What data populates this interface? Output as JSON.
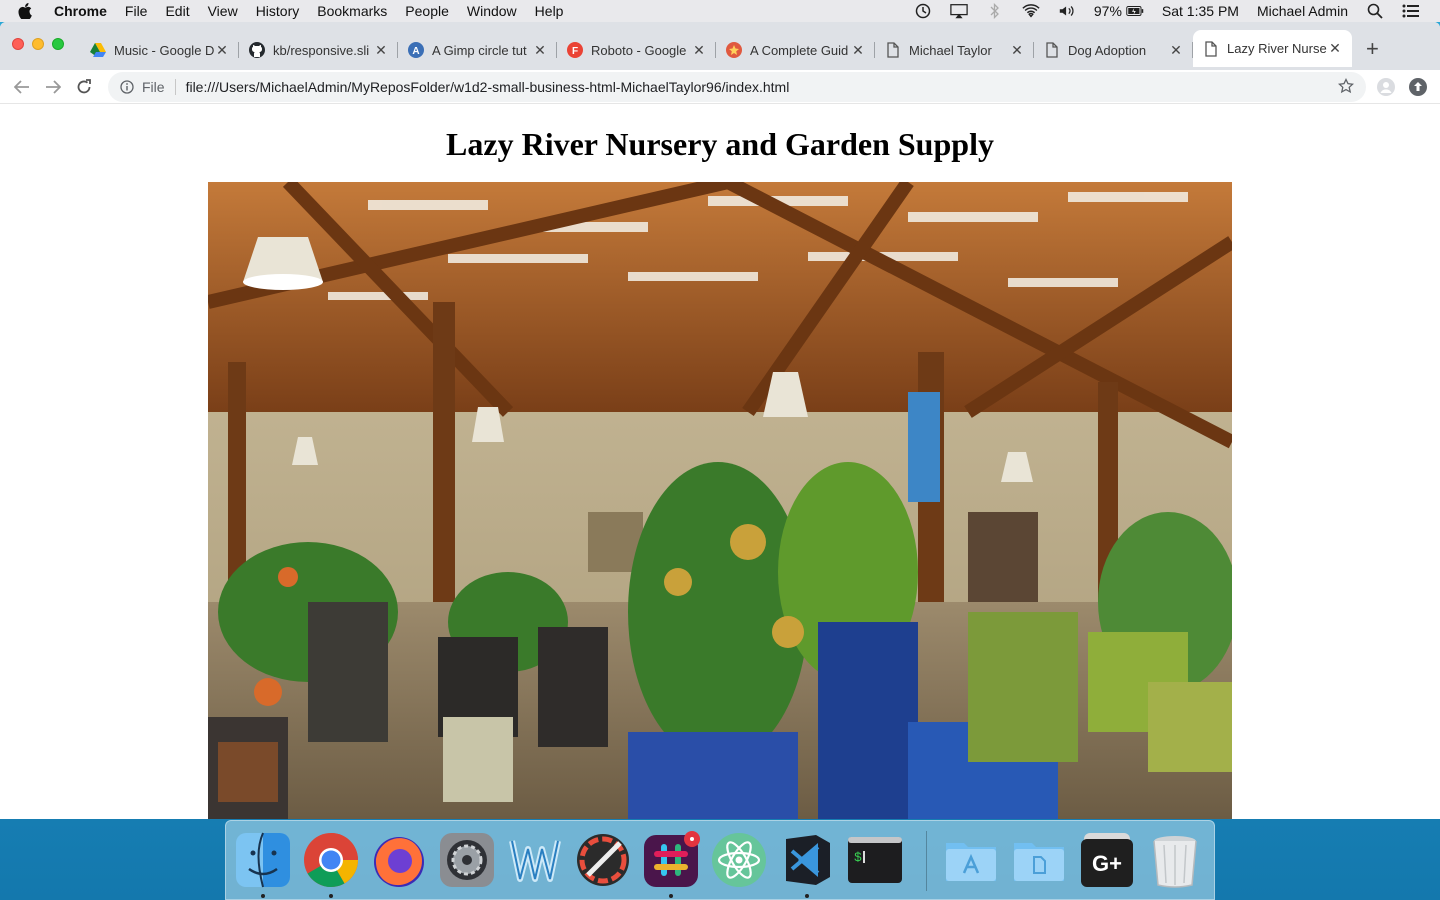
{
  "menubar": {
    "app_name": "Chrome",
    "items": [
      "File",
      "Edit",
      "View",
      "History",
      "Bookmarks",
      "People",
      "Window",
      "Help"
    ],
    "battery": "97%",
    "clock": "Sat 1:35 PM",
    "user": "Michael Admin"
  },
  "browser": {
    "tabs": [
      {
        "title": "Music - Google D",
        "icon": "google-drive-icon"
      },
      {
        "title": "kb/responsive.sli",
        "icon": "github-icon"
      },
      {
        "title": "A Gimp circle tut",
        "icon": "gimp-site-icon"
      },
      {
        "title": "Roboto - Google",
        "icon": "google-fonts-icon"
      },
      {
        "title": "A Complete Guid",
        "icon": "css-tricks-icon"
      },
      {
        "title": "Michael Taylor",
        "icon": "document-icon"
      },
      {
        "title": "Dog Adoption",
        "icon": "document-icon"
      },
      {
        "title": "Lazy River Nurse",
        "icon": "document-icon",
        "active": true
      }
    ],
    "address": {
      "scheme_label": "File",
      "url": "file:///Users/MichaelAdmin/MyReposFolder/w1d2-small-business-html-MichaelTaylor96/index.html"
    }
  },
  "page": {
    "heading": "Lazy River Nursery and Garden Supply",
    "hero_alt": "Garden center interior with potted plants and hanging lamps"
  },
  "dock": {
    "apps": [
      "Finder",
      "Google Chrome",
      "Firefox",
      "System Preferences",
      "Wunderlist",
      "Pixelmator",
      "Slack",
      "Atom",
      "Visual Studio Code",
      "Terminal",
      "Applications",
      "Documents",
      "Google Plus",
      "Trash"
    ]
  },
  "colors": {
    "tabstrip": "#dee1e6",
    "dock_bg": "#1c8fc4"
  }
}
